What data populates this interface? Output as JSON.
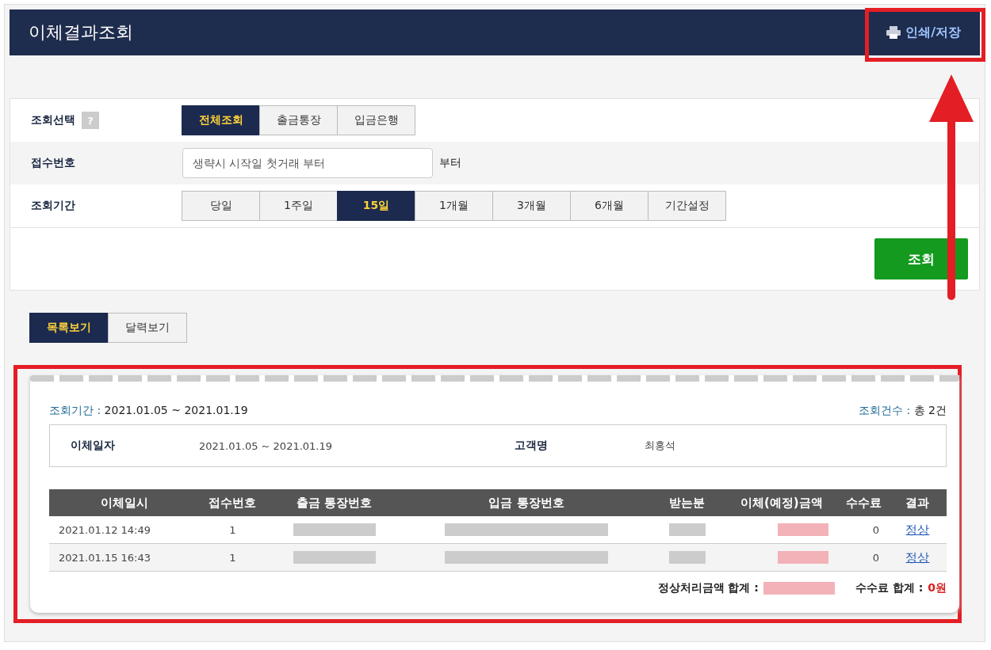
{
  "header": {
    "title": "이체결과조회",
    "print_button": "인쇄/저장"
  },
  "filters": [
    {
      "kind": "buttons",
      "label": "조회선택",
      "help": "?",
      "options": [
        {
          "label": "전체조회",
          "selected": true
        },
        {
          "label": "출금통장",
          "selected": false
        },
        {
          "label": "입금은행",
          "selected": false
        }
      ]
    },
    {
      "kind": "input",
      "label": "접수번호",
      "placeholder": "생략시 시작일 첫거래 부터",
      "suffix": "부터"
    },
    {
      "kind": "buttons",
      "label": "조회기간",
      "options": [
        {
          "label": "당일",
          "selected": false
        },
        {
          "label": "1주일",
          "selected": false
        },
        {
          "label": "15일",
          "selected": true
        },
        {
          "label": "1개월",
          "selected": false
        },
        {
          "label": "3개월",
          "selected": false
        },
        {
          "label": "6개월",
          "selected": false
        },
        {
          "label": "기간설정",
          "selected": false
        }
      ]
    }
  ],
  "search_button": "조회",
  "view_tabs": [
    {
      "label": "목록보기",
      "selected": true
    },
    {
      "label": "달력보기",
      "selected": false
    }
  ],
  "result": {
    "period_label": "조회기간 :",
    "period": "2021.01.05 ~ 2021.01.19",
    "count_label": "조회건수 :",
    "count": "총 2건",
    "summary": [
      {
        "label": "이체일자",
        "value": "2021.01.05 ~ 2021.01.19"
      },
      {
        "label": "고객명",
        "value": "최홍석"
      }
    ],
    "columns": [
      "이체일시",
      "접수번호",
      "출금 통장번호",
      "입금 통장번호",
      "받는분",
      "이체(예정)금액",
      "수수료",
      "결과"
    ],
    "rows": [
      {
        "datetime": "2021.01.12 14:49",
        "receipt_no": "1",
        "fee": "0",
        "result": "정상"
      },
      {
        "datetime": "2021.01.15 16:43",
        "receipt_no": "1",
        "fee": "0",
        "result": "정상"
      }
    ],
    "total_label": "정상처리금액 합계 :",
    "fee_total_label": "수수료 합계 :",
    "fee_total": "0원"
  }
}
